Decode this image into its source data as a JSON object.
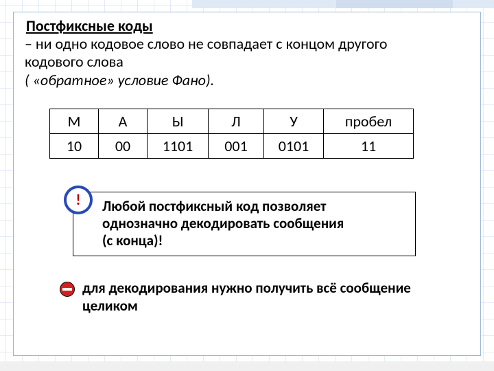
{
  "title": "Постфиксные коды",
  "definition_line1": "– ни одно кодовое слово не совпадает с концом другого",
  "definition_line2": "кодового слова",
  "definition_fano": "( «обратное» условие Фано).",
  "chart_data": {
    "type": "table",
    "headers": [
      "М",
      "А",
      "Ы",
      "Л",
      "У",
      "пробел"
    ],
    "values": [
      "10",
      "00",
      "1101",
      "001",
      "0101",
      "11"
    ]
  },
  "badge": "!",
  "note_line1": "Любой постфиксный код позволяет",
  "note_line2": "однозначно декодировать сообщения",
  "note_line3": "(с конца)!",
  "warn_line1": "для декодирования нужно получить всё сообщение",
  "warn_line2": "целиком"
}
